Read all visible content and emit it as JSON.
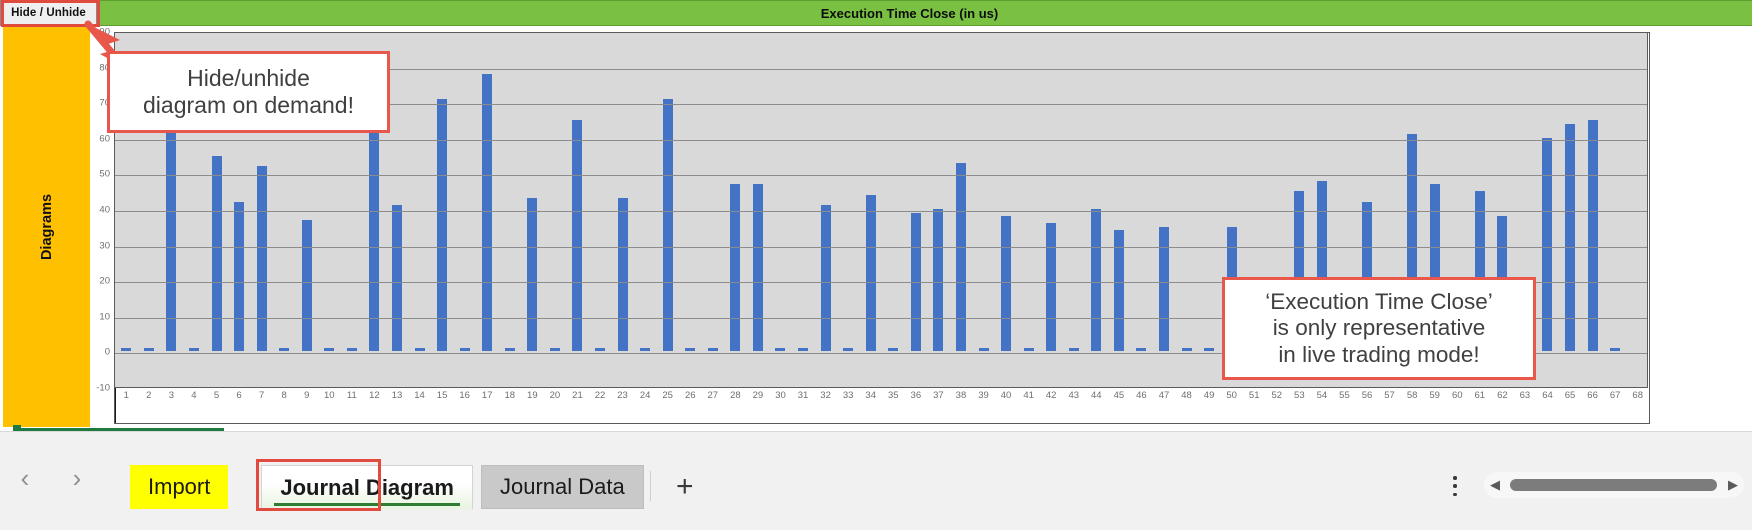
{
  "topbar": {
    "hide_unhide_label": "Hide / Unhide",
    "chart_title": "Execution Time Close (in us)",
    "band_color": "#7ac143"
  },
  "sidebar": {
    "label": "Diagrams",
    "color": "#ffc000"
  },
  "callouts": [
    {
      "id": "hide-unhide-callout",
      "line1": "Hide/unhide",
      "line2": "diagram on demand!"
    },
    {
      "id": "execution-time-callout",
      "line1": "‘Execution Time Close’",
      "line2": "is only representative",
      "line3": "in live trading mode!"
    }
  ],
  "tabbar": {
    "prev_label": "‹",
    "next_label": "›",
    "tabs": [
      {
        "label": "Import",
        "selected": false,
        "style": "highlight-yellow"
      },
      {
        "label": "Journal Diagram",
        "selected": true,
        "style": "active"
      },
      {
        "label": "Journal Data",
        "selected": false,
        "style": "inactive"
      }
    ],
    "add_sheet_label": "+",
    "more_label": "⋮",
    "scroll_left_label": "◀",
    "scroll_right_label": "▶"
  },
  "chart_data": {
    "type": "bar",
    "title": "Execution Time Close (in us)",
    "xlabel": "",
    "ylabel": "",
    "ylim": [
      -10,
      90
    ],
    "yticks": [
      90,
      80,
      70,
      60,
      50,
      40,
      30,
      20,
      10,
      0,
      -10
    ],
    "grid": true,
    "legend": "none",
    "bar_color": "#4472c4",
    "plot_background": "#d9d9d9",
    "categories": [
      "1",
      "2",
      "3",
      "4",
      "5",
      "6",
      "7",
      "8",
      "9",
      "10",
      "11",
      "12",
      "13",
      "14",
      "15",
      "16",
      "17",
      "18",
      "19",
      "20",
      "21",
      "22",
      "23",
      "24",
      "25",
      "26",
      "27",
      "28",
      "29",
      "30",
      "31",
      "32",
      "33",
      "34",
      "35",
      "36",
      "37",
      "38",
      "39",
      "40",
      "41",
      "42",
      "43",
      "44",
      "45",
      "46",
      "47",
      "48",
      "49",
      "50",
      "51",
      "52",
      "53",
      "54",
      "55",
      "56",
      "57",
      "58",
      "59",
      "60",
      "61",
      "62",
      "63",
      "64",
      "65",
      "66",
      "67",
      "68"
    ],
    "values": [
      1,
      1,
      65,
      1,
      55,
      42,
      52,
      1,
      37,
      1,
      1,
      65,
      41,
      1,
      71,
      1,
      78,
      1,
      43,
      1,
      65,
      1,
      43,
      1,
      71,
      1,
      1,
      47,
      47,
      1,
      1,
      41,
      1,
      44,
      1,
      39,
      40,
      53,
      1,
      38,
      1,
      36,
      1,
      40,
      34,
      1,
      35,
      1,
      1,
      35,
      1,
      1,
      45,
      48,
      1,
      42,
      1,
      61,
      47,
      1,
      45,
      38,
      1,
      60,
      64,
      65,
      1
    ],
    "visible_xlabel_range": "1 to 68",
    "series_note": "Single series of execution time close durations in microseconds"
  }
}
